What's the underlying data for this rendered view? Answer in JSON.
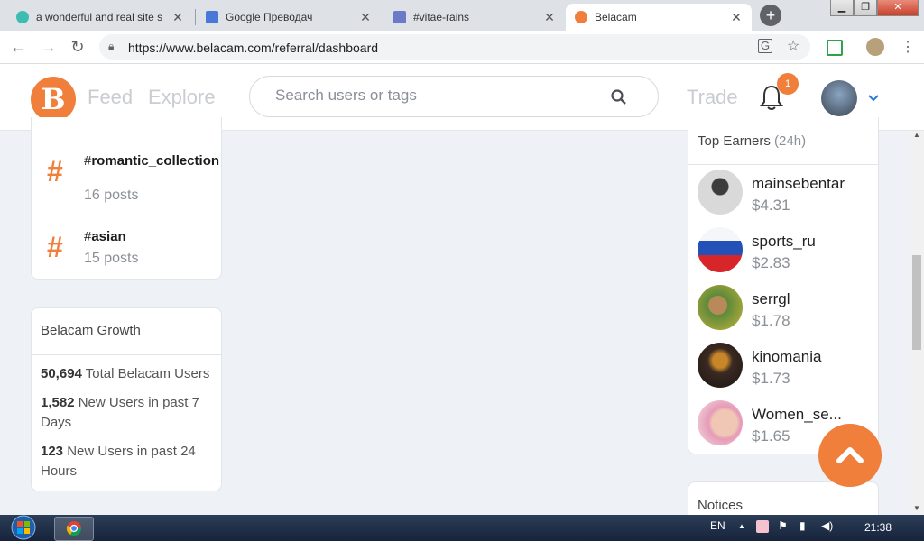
{
  "browser": {
    "tabs": [
      {
        "title": "a wonderful and real site s",
        "active": false
      },
      {
        "title": "Google Преводач",
        "active": false
      },
      {
        "title": "#vitae-rains",
        "active": false
      },
      {
        "title": "Belacam",
        "active": true
      }
    ],
    "url": "https://www.belacam.com/referral/dashboard"
  },
  "header": {
    "nav": [
      "Feed",
      "Explore"
    ],
    "search_placeholder": "Search users or tags",
    "trade": "Trade",
    "notification_count": "1"
  },
  "tags": [
    {
      "prefix": "#",
      "name": "romantic_collection",
      "count": "16 posts"
    },
    {
      "prefix": "#",
      "name": "asian",
      "count": "15 posts"
    }
  ],
  "growth": {
    "title": "Belacam Growth",
    "stats": [
      {
        "value": "50,694",
        "label": "Total Belacam Users"
      },
      {
        "value": "1,582",
        "label": "New Users in past 7 Days"
      },
      {
        "value": "123",
        "label": "New Users in past 24 Hours"
      }
    ]
  },
  "earners": {
    "title": "Top Earners",
    "period": "(24h)",
    "items": [
      {
        "name": "mainsebentar",
        "amount": "$4.31"
      },
      {
        "name": "sports_ru",
        "amount": "$2.83"
      },
      {
        "name": "serrgl",
        "amount": "$1.78"
      },
      {
        "name": "kinomania",
        "amount": "$1.73"
      },
      {
        "name": "Women_se...",
        "amount": "$1.65"
      }
    ]
  },
  "notices": {
    "title": "Notices"
  },
  "taskbar": {
    "lang": "EN",
    "time": "21:38"
  },
  "colors": {
    "accent": "#f07f3c",
    "muted": "#8a8f96",
    "background": "#eef1f5"
  }
}
